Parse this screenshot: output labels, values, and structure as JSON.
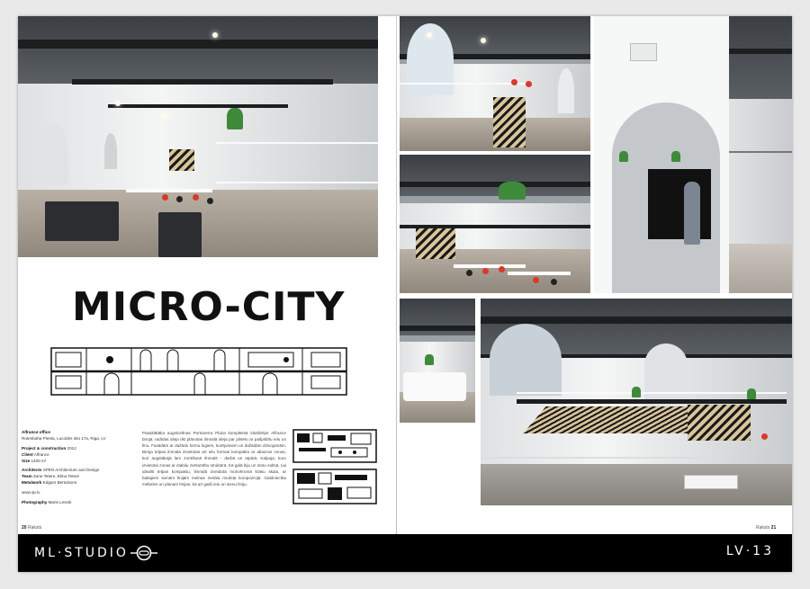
{
  "article": {
    "title": "MICRO-CITY",
    "credits": {
      "project_name": "Alfrance office",
      "address": "Rotenbaha Piesta, Lucodes iela 17a, Riga, LV",
      "project_label": "Project & construction",
      "project_value": "2012",
      "client_label": "Client",
      "client_value": "Alfrance",
      "size_label": "Size",
      "size_value": "1400 m²",
      "architects_label": "Architects",
      "architects_value": "SPEN Architecture and Design",
      "team_label": "Team",
      "team_value": "Zane Tetere, Elina Tetere",
      "metalwork_label": "Metalwork",
      "metalwork_value": "Edgars Bertulsons",
      "website": "www.sp.lv",
      "photo_label": "Photography",
      "photo_value": "Maris Lesnik"
    },
    "body": "Pasaklātāka augstceltnas Portonerra Plaza kompleksā lokālizējot Alfrance birojā, radīdas ideja tikt plānotas ilmnalā ideja par pilsētu ar pašpildītu ielu un līnu. Fasādām ar dažādo formu logiem, kurējumiem un dažādām dzīvojamām. Biroja telpas ilmnalā izvietotas arī ielu formas kompaktu ar atlaicīus zonas, kuri augstākajā lam zonēšanā ilmnalā - darbā un atpūtā. Kalpuja, kuru izvietotai zonas ar stabilu zvērantību struktūrā. Kā galā biju uz mūru solīsā. Lai idealīti telpas kompaktu, ilmnalā izveidotā monohromā krāsu skala, ar baltajiem sienām līnijām melnas metāla modeļa kompozīcijā. Galdniecība mēbeles un planam līnijas, kā arī gaiši ielu un sienu līniju."
  },
  "folio": {
    "left_num": "20",
    "left_label": "Raksts",
    "right_num": "21",
    "right_label": "Raksts"
  },
  "footer": {
    "brand": "ML·STUDIO",
    "issue": "LV·13"
  },
  "colors": {
    "footer_bg": "#000000",
    "accent_chair": "#d9382b",
    "sofa": "#2b2d30"
  }
}
